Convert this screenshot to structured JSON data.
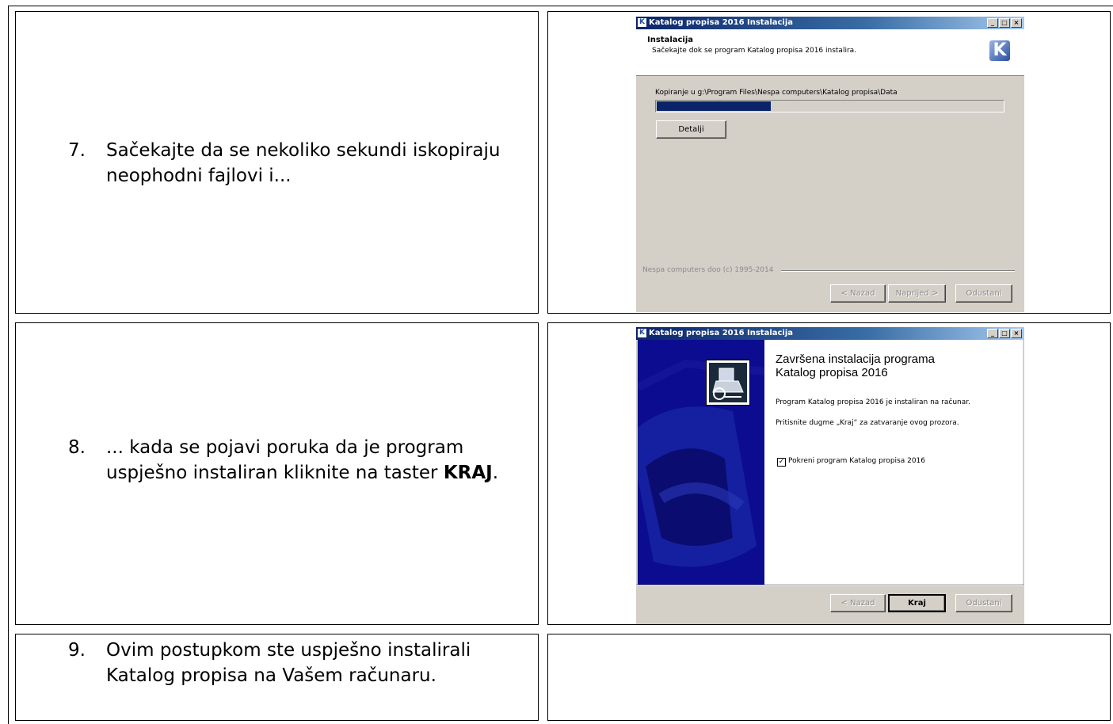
{
  "steps": [
    {
      "num": "7.",
      "line1": "Sačekajte da se nekoliko sekundi iskopiraju",
      "line2": "neophodni fajlovi i..."
    },
    {
      "num": "8.",
      "line1": "... kada se pojavi poruka da je program",
      "line2_pre": "uspješno instaliran kliknite na taster ",
      "line2_bold": "KRAJ",
      "line2_post": "."
    },
    {
      "num": "9.",
      "line1": "Ovim postupkom ste uspješno instalirali",
      "line2": "Katalog propisa na Vašem računaru."
    }
  ],
  "dialog1": {
    "title": "Katalog propisa 2016 Instalacija",
    "header_title": "Instalacija",
    "header_subtitle": "Sačekajte dok se program Katalog propisa 2016 instalira.",
    "logo_letter": "K",
    "status": "Kopiranje u g:\\Program Files\\Nespa computers\\Katalog propisa\\Data",
    "progress": 0.33,
    "details_button": "Detalji",
    "footer": "Nespa computers doo (c) 1995-2014",
    "back_button": "< Nazad",
    "next_button": "Naprijed >",
    "cancel_button": "Odustani"
  },
  "dialog2": {
    "title": "Katalog propisa 2016 Instalacija",
    "heading_line1": "Završena instalacija programa",
    "heading_line2": "Katalog propisa 2016",
    "message": "Program Katalog propisa 2016 je instaliran na računar.",
    "hint": "Pritisnite dugme „Kraj“ za zatvaranje ovog prozora.",
    "checkbox_label": "Pokreni program Katalog propisa 2016",
    "checkbox_checked": true,
    "back_button": "< Nazad",
    "finish_button": "Kraj",
    "cancel_button": "Odustani"
  },
  "window_buttons": {
    "minimize": "_",
    "maximize": "□",
    "close": "×"
  },
  "colors": {
    "titlebar": "#0a246a",
    "progress": "#0a246a",
    "wizard_panel": "#0a0a8a",
    "dialog_face": "#d4d0c8"
  }
}
